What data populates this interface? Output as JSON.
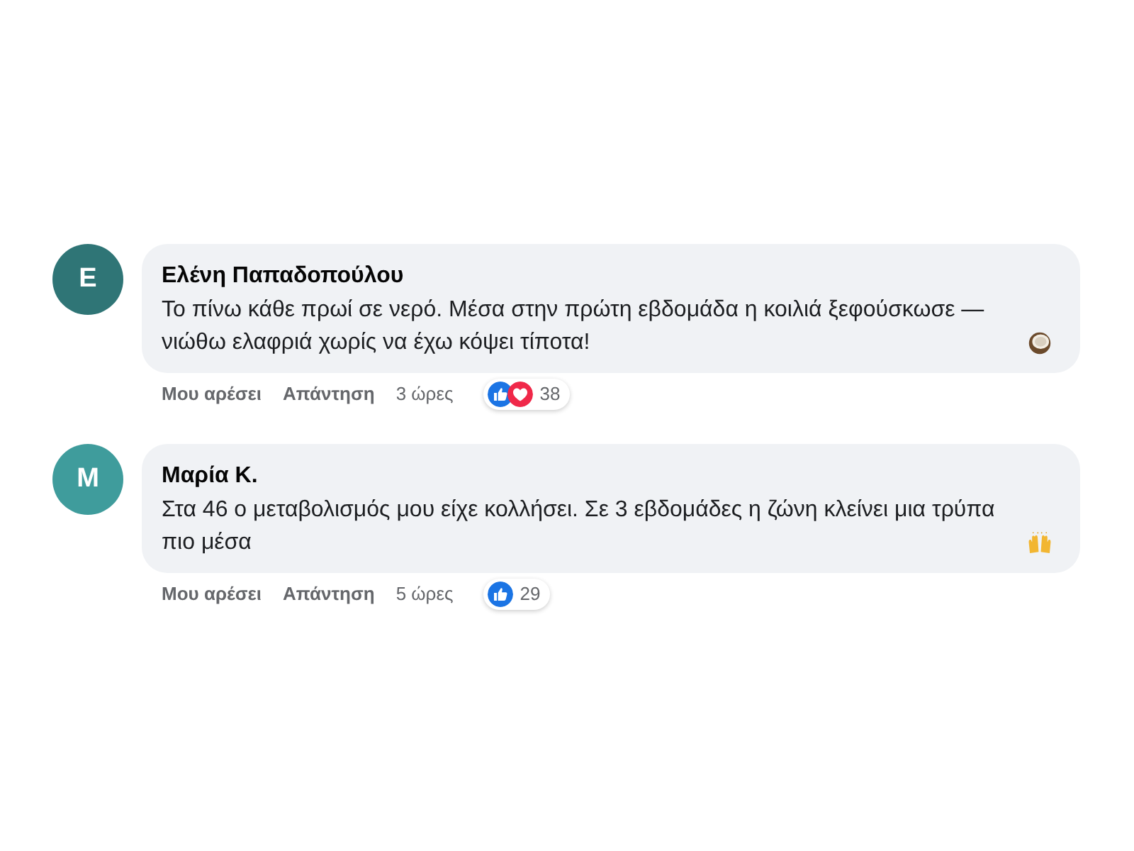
{
  "comments": [
    {
      "avatar": {
        "initial": "E",
        "color": "#2f7576"
      },
      "author": "Ελένη Παπαδοπούλου",
      "text": "Το πίνω κάθε πρωί σε νερό. Μέσα στην πρώτη εβδομάδα η κοιλιά ξεφούσκωσε — νιώθω ελαφριά χωρίς να έχω κόψει τίποτα!",
      "emoji": {
        "kind": "coconut"
      },
      "actions": [
        {
          "label": "Μου αρέσει"
        },
        {
          "label": "Απάντηση"
        }
      ],
      "time": "3 ώρες",
      "reactions": [
        {
          "kind": "like"
        },
        {
          "kind": "love"
        }
      ],
      "reaction_count": "38"
    },
    {
      "avatar": {
        "initial": "M",
        "color": "#3f9c9c"
      },
      "author": "Μαρία Κ.",
      "text": "Στα 46 ο μεταβολισμός μου είχε κολλήσει. Σε 3 εβδομάδες η ζώνη κλείνει μια τρύπα πιο μέσα",
      "emoji": {
        "kind": "raised-hands"
      },
      "actions": [
        {
          "label": "Μου αρέσει"
        },
        {
          "label": "Απάντηση"
        }
      ],
      "time": "5 ώρες",
      "reactions": [
        {
          "kind": "like"
        }
      ],
      "reaction_count": "29"
    }
  ]
}
